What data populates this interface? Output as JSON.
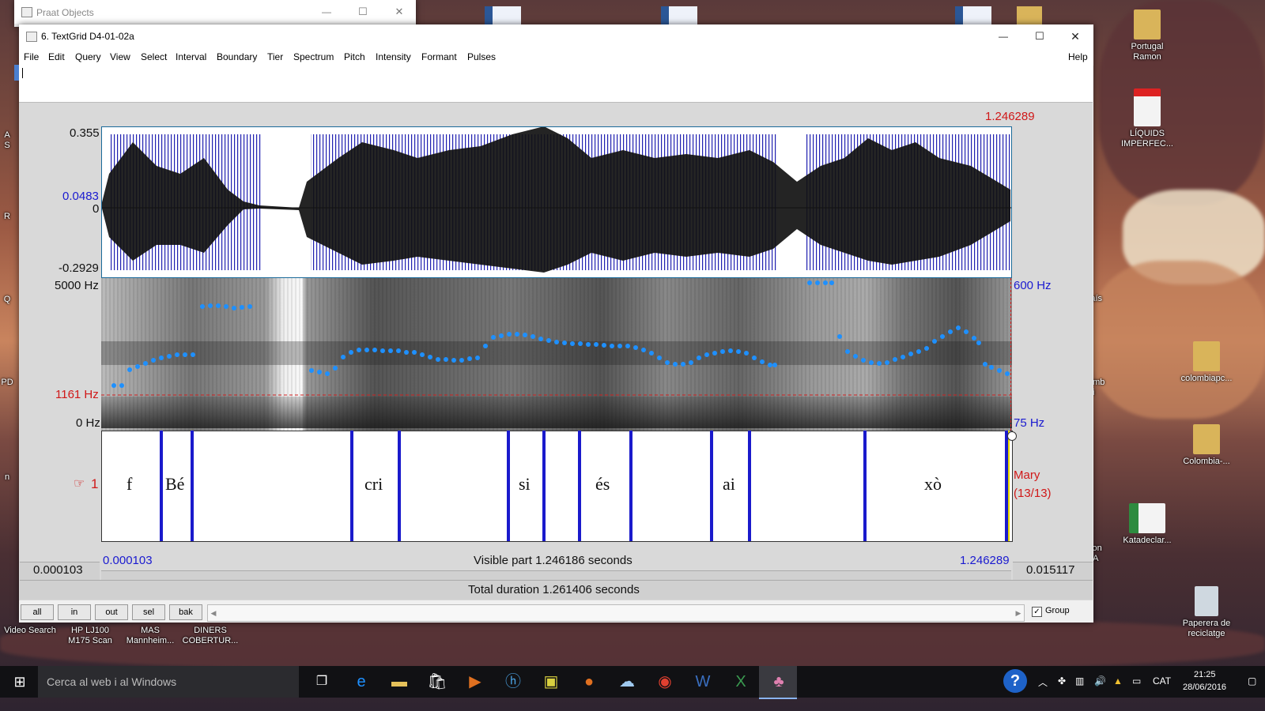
{
  "desktop": {
    "icons_right": [
      {
        "label": "Portugal\nRamon",
        "color": "#d9b45a"
      },
      {
        "label": "LÍQUIDS\nIMPERFEC...",
        "color": "#e0e0e0"
      },
      {
        "label": "colombiapc...",
        "color": "#d9b45a"
      },
      {
        "label": "Colombia-...",
        "color": "#d9b45a"
      },
      {
        "label": "Katadeclar...",
        "color": "#2e8b3f"
      },
      {
        "label": "Paperera de\nreciclatge",
        "color": "#cfd8e0"
      }
    ],
    "icons_bottom": [
      "Video Search",
      "HP LJ100\nM175 Scan",
      "MAS\nMannheim...",
      "DINERS\nCOBERTUR..."
    ],
    "partial_right_labels": [
      "País",
      "amb\npi",
      "tion\nLA"
    ],
    "partial_left_labels": [
      "A\nS",
      "R",
      "Q",
      "PD",
      "n"
    ]
  },
  "praat_objects": {
    "title": "Praat Objects",
    "minimize": "—",
    "maximize": "☐",
    "close": "✕"
  },
  "textgrid_window": {
    "title": "6. TextGrid D4-01-02a",
    "minimize": "—",
    "maximize": "☐",
    "close": "✕",
    "menu": [
      "File",
      "Edit",
      "Query",
      "View",
      "Select",
      "Interval",
      "Boundary",
      "Tier",
      "Spectrum",
      "Pitch",
      "Intensity",
      "Formant",
      "Pulses"
    ],
    "help": "Help",
    "cursor_time_top": "1.246289",
    "waveform": {
      "top": "0.355",
      "mid_blue": "0.0483",
      "zero": "0",
      "bottom": "-0.2929"
    },
    "spectrogram": {
      "freq_top": "5000 Hz",
      "freq_cursor": "1161 Hz",
      "freq_bottom": "0 Hz",
      "pitch_top": "600 Hz",
      "pitch_bottom": "75 Hz"
    },
    "tier": {
      "number": "1",
      "pointer_icon": "☞",
      "name": "Mary",
      "count": "(13/13)",
      "intervals": [
        "f",
        "Bé",
        "cri",
        "si",
        "és",
        "ai",
        "xò"
      ]
    },
    "bottom": {
      "visible_start": "0.000103",
      "visible_end": "1.246289",
      "visible_part": "Visible part 1.246186 seconds",
      "left_time": "0.000103",
      "right_time": "0.015117",
      "total_duration": "Total duration 1.261406 seconds"
    },
    "buttons": [
      "all",
      "in",
      "out",
      "sel",
      "bak"
    ],
    "group_label": "Group",
    "group_checked": true
  },
  "taskbar": {
    "search_placeholder": "Cerca al web i al Windows",
    "lang": "CAT",
    "time": "21:25",
    "date": "28/06/2016",
    "help_glyph": "?"
  }
}
